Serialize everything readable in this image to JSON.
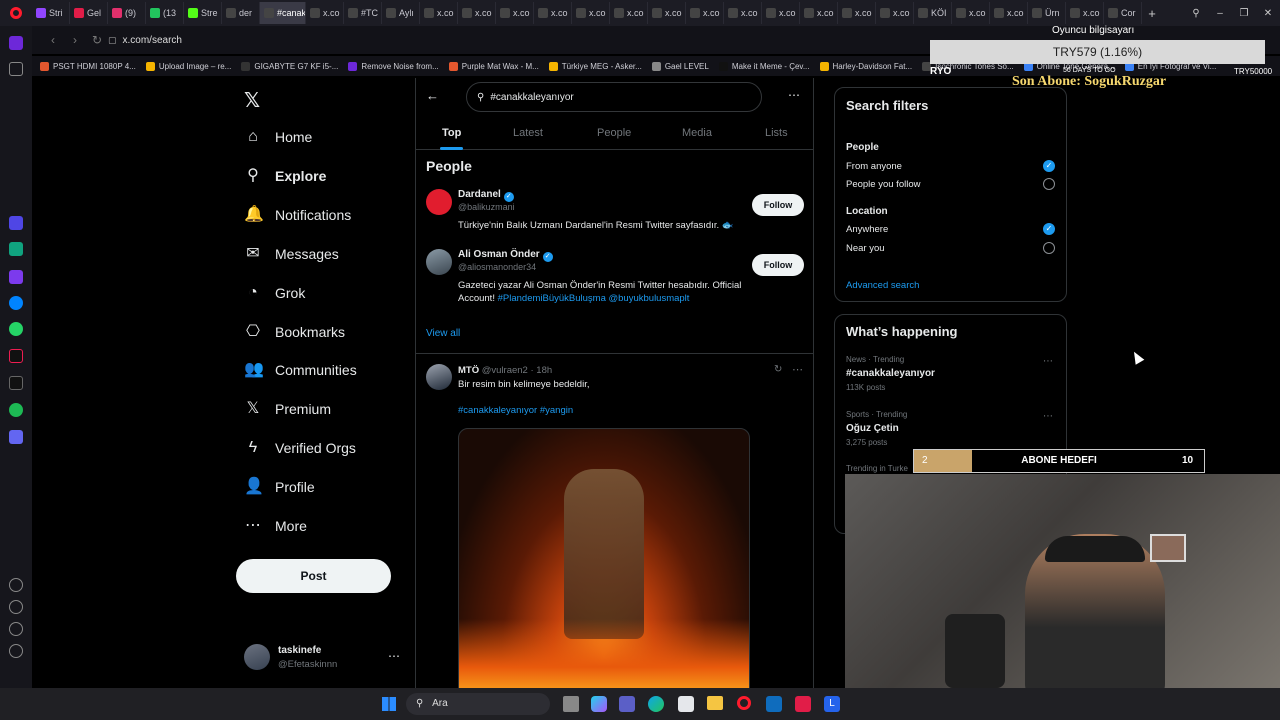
{
  "browser": {
    "tabs": [
      {
        "label": "Stri",
        "color": "#9146ff"
      },
      {
        "label": "Gel",
        "color": "#e11d48"
      },
      {
        "label": "(9)",
        "color": "#e1306c"
      },
      {
        "label": "(13",
        "color": "#22c55e"
      },
      {
        "label": "Stre",
        "color": "#53fc18"
      },
      {
        "label": "der",
        "color": "#444"
      },
      {
        "label": "#canak",
        "color": "#444",
        "active": true
      },
      {
        "label": "x.co",
        "color": "#444"
      },
      {
        "label": "#TC",
        "color": "#444"
      },
      {
        "label": "Aylı",
        "color": "#444"
      },
      {
        "label": "x.co",
        "color": "#444"
      },
      {
        "label": "x.co",
        "color": "#444"
      },
      {
        "label": "x.co",
        "color": "#444"
      },
      {
        "label": "x.co",
        "color": "#444"
      },
      {
        "label": "x.co",
        "color": "#444"
      },
      {
        "label": "x.co",
        "color": "#444"
      },
      {
        "label": "x.co",
        "color": "#444"
      },
      {
        "label": "x.co",
        "color": "#444"
      },
      {
        "label": "x.co",
        "color": "#444"
      },
      {
        "label": "x.co",
        "color": "#444"
      },
      {
        "label": "x.co",
        "color": "#444"
      },
      {
        "label": "x.co",
        "color": "#444"
      },
      {
        "label": "x.co",
        "color": "#444"
      },
      {
        "label": "KÖI",
        "color": "#444"
      },
      {
        "label": "x.co",
        "color": "#444"
      },
      {
        "label": "x.co",
        "color": "#444"
      },
      {
        "label": "Ürn",
        "color": "#444"
      },
      {
        "label": "x.co",
        "color": "#444"
      },
      {
        "label": "Cor",
        "color": "#444"
      }
    ],
    "url": "x.com/search",
    "bookmarks": [
      {
        "label": "PSGT HDMI 1080P 4...",
        "color": "#e4572e"
      },
      {
        "label": "Upload Image – re...",
        "color": "#f5b400"
      },
      {
        "label": "GIGABYTE G7 KF i5-...",
        "color": "#333"
      },
      {
        "label": "Remove Noise from...",
        "color": "#6d28d9"
      },
      {
        "label": "Purple Mat Wax - M...",
        "color": "#e4572e"
      },
      {
        "label": "Türkiye MEG - Asker...",
        "color": "#f5b400"
      },
      {
        "label": "Gael LEVEL",
        "color": "#888"
      },
      {
        "label": "Make it Meme - Çev...",
        "color": "#111"
      },
      {
        "label": "Harley-Davidson Fat...",
        "color": "#f5b400"
      },
      {
        "label": "Isochronic Tones So...",
        "color": "#444"
      },
      {
        "label": "Online Tone Genera...",
        "color": "#3b82f6"
      },
      {
        "label": "En İyi Fotoğraf ve Vi...",
        "color": "#3b82f6"
      }
    ]
  },
  "nav": {
    "items": [
      {
        "label": "Home",
        "icon": "home-icon",
        "glyph": "⌂"
      },
      {
        "label": "Explore",
        "icon": "search-icon",
        "glyph": "⚲",
        "bold": true
      },
      {
        "label": "Notifications",
        "icon": "bell-icon",
        "glyph": "🔔"
      },
      {
        "label": "Messages",
        "icon": "mail-icon",
        "glyph": "✉"
      },
      {
        "label": "Grok",
        "icon": "grok-icon",
        "glyph": "◔"
      },
      {
        "label": "Bookmarks",
        "icon": "bookmark-icon",
        "glyph": "⎔"
      },
      {
        "label": "Communities",
        "icon": "people-icon",
        "glyph": "👥"
      },
      {
        "label": "Premium",
        "icon": "x-icon",
        "glyph": "𝕏"
      },
      {
        "label": "Verified Orgs",
        "icon": "bolt-icon",
        "glyph": "ϟ"
      },
      {
        "label": "Profile",
        "icon": "person-icon",
        "glyph": "👤"
      },
      {
        "label": "More",
        "icon": "more-icon",
        "glyph": "⋯"
      }
    ],
    "post_label": "Post",
    "account_name": "taskinefe",
    "account_handle": "@Efetaskinnn"
  },
  "search": {
    "query": "#canakkaleyanıyor",
    "tabs": [
      "Top",
      "Latest",
      "People",
      "Media",
      "Lists"
    ]
  },
  "people_section": {
    "title": "People",
    "view_all": "View all",
    "follow_label": "Follow",
    "people": [
      {
        "name": "Dardanel",
        "handle": "@balikuzmani",
        "bio_lines": [
          "Türkiye'nin Balık Uzmanı Dardanel'in Resmi Twitter sayfasıdır. 🐟"
        ],
        "links": "",
        "avatar_color": "#e11d2e"
      },
      {
        "name": "Ali Osman Önder",
        "handle": "@aliosmanonder34",
        "bio_lines": [
          "Gazeteci yazar Ali Osman Önder'in Resmi Twitter hesabıdır. Official",
          "Account!"
        ],
        "links": "#PlandemiBüyükBuluşma @buyukbulusmaplt",
        "avatar_color": "#4a5a66"
      }
    ]
  },
  "tweet": {
    "name": "MTÖ",
    "handle": "@vulraen2",
    "time": "18h",
    "text": "Bir resim bin kelimeye bedeldir,",
    "hashtags": "#canakkaleyanıyor #yangin"
  },
  "filters": {
    "title": "Search filters",
    "people_label": "People",
    "people_opts": [
      {
        "label": "From anyone",
        "on": true
      },
      {
        "label": "People you follow",
        "on": false
      }
    ],
    "location_label": "Location",
    "location_opts": [
      {
        "label": "Anywhere",
        "on": true
      },
      {
        "label": "Near you",
        "on": false
      }
    ],
    "advanced": "Advanced search"
  },
  "happening": {
    "title": "What’s happening",
    "items": [
      {
        "meta": "News · Trending",
        "topic": "#canakkaleyanıyor",
        "count": "113K posts"
      },
      {
        "meta": "Sports · Trending",
        "topic": "Oğuz Çetin",
        "count": "3,275 posts"
      }
    ],
    "partial": "Trending in Turke"
  },
  "overlay": {
    "pc_label": "Oyuncu bilgisayarı",
    "stock": "TRY579 (1.16%)",
    "ryo": "RYO",
    "days": "56 DAYS TO GO",
    "try_target": "TRY50000",
    "subscriber": "Son Abone: SogukRuzgar",
    "goal_current": "2",
    "goal_label": "ABONE HEDEFI",
    "goal_target": "10",
    "goal_fraction": 0.2
  },
  "taskbar": {
    "search_placeholder": "Ara"
  }
}
